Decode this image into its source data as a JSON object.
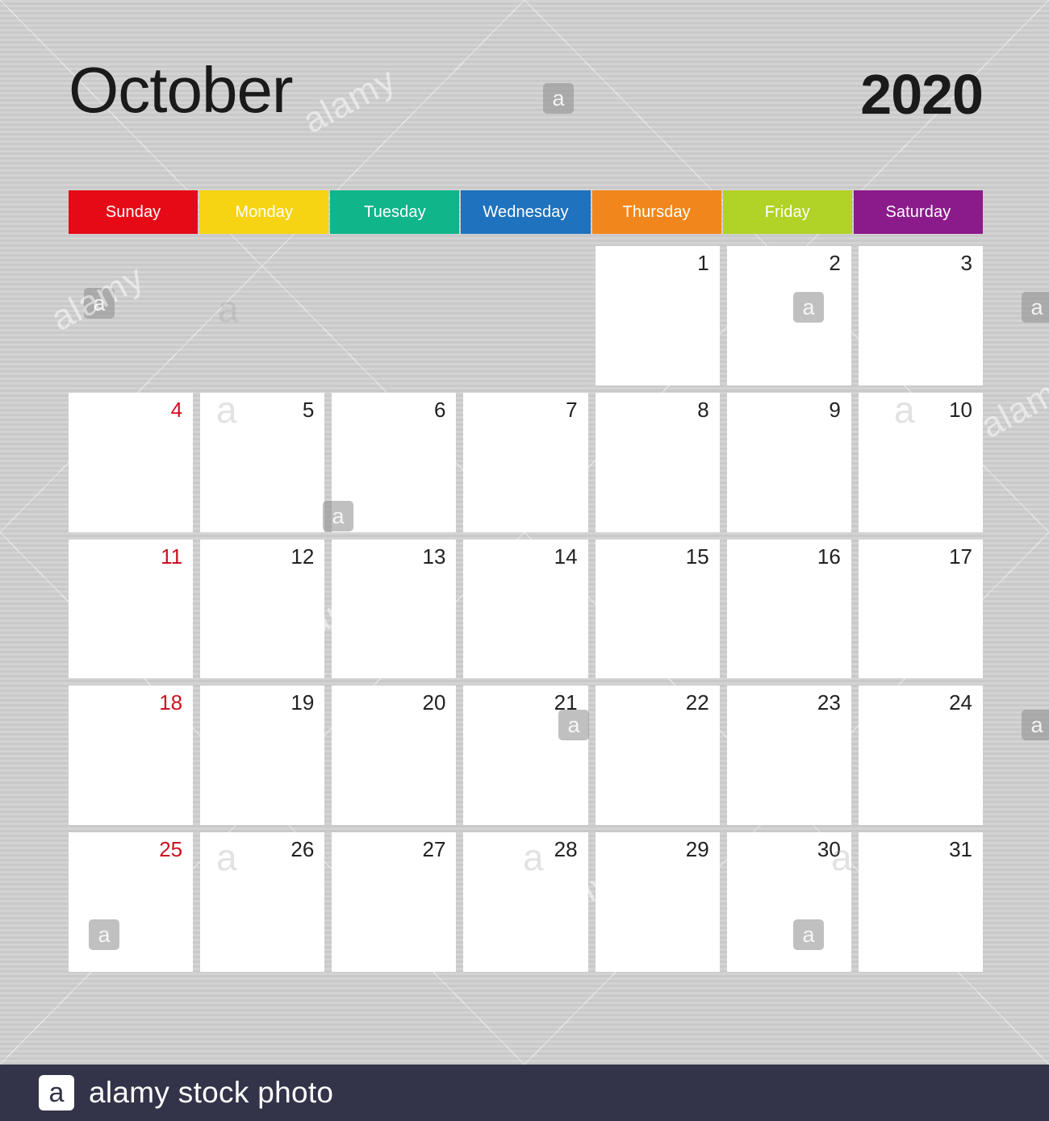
{
  "header": {
    "month": "October",
    "year": "2020"
  },
  "weekdays": [
    {
      "label": "Sunday",
      "color": "#e60a17"
    },
    {
      "label": "Monday",
      "color": "#f6d313"
    },
    {
      "label": "Tuesday",
      "color": "#10b58a"
    },
    {
      "label": "Wednesday",
      "color": "#1f72bd"
    },
    {
      "label": "Thursday",
      "color": "#f1871c"
    },
    {
      "label": "Friday",
      "color": "#b1d226"
    },
    {
      "label": "Saturday",
      "color": "#8b1a8b"
    }
  ],
  "grid": {
    "weeks": [
      [
        "",
        "",
        "",
        "",
        "1",
        "2",
        "3"
      ],
      [
        "4",
        "5",
        "6",
        "7",
        "8",
        "9",
        "10"
      ],
      [
        "11",
        "12",
        "13",
        "14",
        "15",
        "16",
        "17"
      ],
      [
        "18",
        "19",
        "20",
        "21",
        "22",
        "23",
        "24"
      ],
      [
        "25",
        "26",
        "27",
        "28",
        "29",
        "30",
        "31"
      ]
    ],
    "sunday_color": "#cc1122",
    "weekday_color": "#222222"
  },
  "watermark": {
    "badge_glyph": "a",
    "ghost_glyph": "a",
    "word": "alamy"
  },
  "footer": {
    "logo_glyph": "a",
    "text": "alamy stock photo",
    "background": "#333349"
  }
}
